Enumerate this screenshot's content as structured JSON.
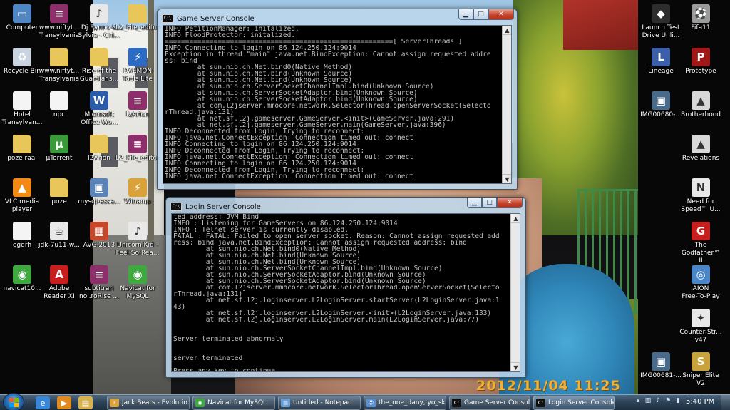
{
  "wallpaper": {
    "date_stamp": "2012/11/04  11:25"
  },
  "desktop_icons_left": [
    {
      "label": "Computer",
      "icon": "computer-icon",
      "color": "#4f86c6",
      "glyph": "▭"
    },
    {
      "label": "www.niftyt...\nTransylvania",
      "icon": "rar-archive-icon",
      "color": "#8c2f6b",
      "glyph": "≡"
    },
    {
      "label": "Dj Rynno &\nSylvia - Chi...",
      "icon": "audio-file-icon",
      "color": "#e8e8e8",
      "glyph": "♪"
    },
    {
      "label": "L2_File_editor",
      "icon": "folder-icon",
      "color": "#e9c65a",
      "glyph": ""
    },
    {
      "label": "Recycle Bin",
      "icon": "recycle-bin-icon",
      "color": "#c9d4e0",
      "glyph": "♻"
    },
    {
      "label": "www.niftyt...\nTransylvania",
      "icon": "folder-icon",
      "color": "#e9c65a",
      "glyph": ""
    },
    {
      "label": "Rise of the\nGuardians...",
      "icon": "folder-icon",
      "color": "#e9c65a",
      "glyph": ""
    },
    {
      "label": "DAEMON\nTools Lite",
      "icon": "daemon-tools-icon",
      "color": "#2b6bc4",
      "glyph": "⚡"
    },
    {
      "label": "Hotel\nTransylvan...",
      "icon": "text-file-icon",
      "color": "#f4f4f4",
      "glyph": ""
    },
    {
      "label": "npc",
      "icon": "text-file-icon",
      "color": "#f4f4f4",
      "glyph": ""
    },
    {
      "label": "Microsoft\nOffice Wo...",
      "icon": "word-icon",
      "color": "#2a5caa",
      "glyph": "W"
    },
    {
      "label": "l2Arion",
      "icon": "rar-archive-icon",
      "color": "#8c2f6b",
      "glyph": "≡"
    },
    {
      "label": "poze raal",
      "icon": "folder-icon",
      "color": "#e9c65a",
      "glyph": ""
    },
    {
      "label": "µTorrent",
      "icon": "utorrent-icon",
      "color": "#3a9a3a",
      "glyph": "µ"
    },
    {
      "label": "l2Arion",
      "icon": "folder-icon",
      "color": "#e9c65a",
      "glyph": ""
    },
    {
      "label": "L2_File_editor",
      "icon": "rar-archive-icon",
      "color": "#8c2f6b",
      "glyph": "≡"
    },
    {
      "label": "VLC media\nplayer",
      "icon": "vlc-icon",
      "color": "#f08a14",
      "glyph": "▲"
    },
    {
      "label": "poze",
      "icon": "folder-icon",
      "color": "#e9c65a",
      "glyph": ""
    },
    {
      "label": "mysql-esse...",
      "icon": "installer-icon",
      "color": "#5a84b8",
      "glyph": "▣"
    },
    {
      "label": "Winamp",
      "icon": "winamp-icon",
      "color": "#d9a23a",
      "glyph": "⚡"
    },
    {
      "label": "egdrh",
      "icon": "text-file-icon",
      "color": "#f4f4f4",
      "glyph": ""
    },
    {
      "label": "jdk-7u11-w...",
      "icon": "java-icon",
      "color": "#e8e8e8",
      "glyph": "☕"
    },
    {
      "label": "AVG 2013",
      "icon": "avg-icon",
      "color": "#c8462a",
      "glyph": "▦"
    },
    {
      "label": "Unicorn Kid -\nFeel So Rea...",
      "icon": "audio-file-icon",
      "color": "#e8e8e8",
      "glyph": "♪"
    },
    {
      "label": "navicat10...",
      "icon": "navicat-icon",
      "color": "#3fa83f",
      "glyph": "◉"
    },
    {
      "label": "Adobe\nReader XI",
      "icon": "adobe-reader-icon",
      "color": "#c81e1e",
      "glyph": "A"
    },
    {
      "label": "subtitrari\nnoi.roRise ...",
      "icon": "rar-archive-icon",
      "color": "#8c2f6b",
      "glyph": "≡"
    },
    {
      "label": "Navicat for\nMySQL",
      "icon": "navicat-icon",
      "color": "#3fa83f",
      "glyph": "◉"
    }
  ],
  "desktop_icons_right": [
    {
      "label": "Launch Test\nDrive Unli...",
      "icon": "game-icon",
      "color": "#2d2d2d",
      "glyph": "◆"
    },
    {
      "label": "Fifa11",
      "icon": "fifa-icon",
      "color": "#9a9a9a",
      "glyph": "⚽"
    },
    {
      "label": "Lineage",
      "icon": "lineage-icon",
      "color": "#3b5fa8",
      "glyph": "L"
    },
    {
      "label": "Prototype",
      "icon": "prototype-icon",
      "color": "#a01818",
      "glyph": "P"
    },
    {
      "label": "IMG00680-...",
      "icon": "image-file-icon",
      "color": "#4a6a8a",
      "glyph": "▣"
    },
    {
      "label": "Brotherhood",
      "icon": "assassins-creed-icon",
      "color": "#d8d8d8",
      "glyph": "▲"
    },
    {
      "label": "",
      "icon": "",
      "color": "",
      "glyph": ""
    },
    {
      "label": "Revelations",
      "icon": "assassins-creed-icon",
      "color": "#d8d8d8",
      "glyph": "▲"
    },
    {
      "label": "",
      "icon": "",
      "color": "",
      "glyph": ""
    },
    {
      "label": "Need for\nSpeed™ U...",
      "icon": "nfs-icon",
      "color": "#e8e8e8",
      "glyph": "N"
    },
    {
      "label": "",
      "icon": "",
      "color": "",
      "glyph": ""
    },
    {
      "label": "The\nGodfather™ II",
      "icon": "godfather-icon",
      "color": "#c81e1e",
      "glyph": "G"
    },
    {
      "label": "",
      "icon": "",
      "color": "",
      "glyph": ""
    },
    {
      "label": "AION\nFree-To-Play",
      "icon": "aion-icon",
      "color": "#4a86c8",
      "glyph": "◎"
    },
    {
      "label": "",
      "icon": "",
      "color": "",
      "glyph": ""
    },
    {
      "label": "Counter-Str...\nv47",
      "icon": "counter-strike-icon",
      "color": "#e8e8e8",
      "glyph": "✦"
    },
    {
      "label": "IMG00681-...",
      "icon": "image-file-icon",
      "color": "#4a6a8a",
      "glyph": "▣"
    },
    {
      "label": "Sniper Elite\nV2",
      "icon": "sniper-elite-icon",
      "color": "#c8a23a",
      "glyph": "S"
    }
  ],
  "game_console": {
    "title": "Game Server Console",
    "lines": [
      "INFO PetitionManager: initalized.",
      "INFO FloodProtector: initalized.",
      "========================================================[ ServerThreads ]",
      "INFO Connecting to login on 86.124.250.124:9014",
      "Exception in thread \"main\" java.net.BindException: Cannot assign requested addre",
      "ss: bind",
      "        at sun.nio.ch.Net.bind0(Native Method)",
      "        at sun.nio.ch.Net.bind(Unknown Source)",
      "        at sun.nio.ch.Net.bind(Unknown Source)",
      "        at sun.nio.ch.ServerSocketChannelImpl.bind(Unknown Source)",
      "        at sun.nio.ch.ServerSocketAdaptor.bind(Unknown Source)",
      "        at sun.nio.ch.ServerSocketAdaptor.bind(Unknown Source)",
      "        at com.l2jserver.mmocore.network.SelectorThread.openServerSocket(Selecto",
      "rThread.java:131)",
      "        at net.sf.l2j.gameserver.GameServer.<init>(GameServer.java:291)",
      "        at net.sf.l2j.gameserver.GameServer.main(GameServer.java:396)",
      "INFO Deconnected from Login, Trying to reconnect:",
      "INFO java.net.ConnectException: Connection timed out: connect",
      "INFO Connecting to login on 86.124.250.124:9014",
      "INFO Deconnected from Login, Trying to reconnect:",
      "INFO java.net.ConnectException: Connection timed out: connect",
      "INFO Connecting to login on 86.124.250.124:9014",
      "INFO Deconnected from Login, Trying to reconnect:",
      "INFO java.net.ConnectException: Connection timed out: connect"
    ]
  },
  "login_console": {
    "title": "Login Server Console",
    "lines": [
      "ted address: JVM_Bind",
      "INFO : Listening for GameServers on 86.124.250.124:9014",
      "INFO : Telnet server is currently disabled.",
      "FATAL : FATAL: Failed to open server socket. Reason: Cannot assign requested add",
      "ress: bind java.net.BindException: Cannot assign requested address: bind",
      "        at sun.nio.ch.Net.bind0(Native Method)",
      "        at sun.nio.ch.Net.bind(Unknown Source)",
      "        at sun.nio.ch.Net.bind(Unknown Source)",
      "        at sun.nio.ch.ServerSocketChannelImpl.bind(Unknown Source)",
      "        at sun.nio.ch.ServerSocketAdaptor.bind(Unknown Source)",
      "        at sun.nio.ch.ServerSocketAdaptor.bind(Unknown Source)",
      "        at com.l2jserver.mmocore.network.SelectorThread.openServerSocket(Selecto",
      "rThread.java:131)",
      "        at net.sf.l2j.loginserver.L2LoginServer.startServer(L2LoginServer.java:1",
      "43)",
      "        at net.sf.l2j.loginserver.L2LoginServer.<init>(L2LoginServer.java:133)",
      "        at net.sf.l2j.loginserver.L2LoginServer.main(L2LoginServer.java:77)",
      "",
      "",
      "Server terminated abnormaly",
      "",
      "",
      "server terminated",
      "",
      "Press any key to continue . . ."
    ]
  },
  "taskbar": {
    "start_label": "Start",
    "quick_launch": [
      {
        "icon": "internet-explorer-icon",
        "color": "#3a86d6",
        "glyph": "e"
      },
      {
        "icon": "windows-media-player-icon",
        "color": "#e08a1e",
        "glyph": "▶"
      },
      {
        "icon": "windows-explorer-icon",
        "color": "#d8b24a",
        "glyph": "▤"
      }
    ],
    "items": [
      {
        "label": "Jack Beats - Evolutio...",
        "icon": "winamp-icon",
        "color": "#d9a23a",
        "glyph": "⚡"
      },
      {
        "label": "Navicat for MySQL",
        "icon": "navicat-icon",
        "color": "#3fa83f",
        "glyph": "◉"
      },
      {
        "label": "Untitled - Notepad",
        "icon": "notepad-icon",
        "color": "#6aa0d8",
        "glyph": "▤"
      },
      {
        "label": "the_one_dany, yo_sk...",
        "icon": "yahoo-messenger-icon",
        "color": "#5a8fd0",
        "glyph": "☺"
      },
      {
        "label": "Game Server Console",
        "icon": "cmd-icon",
        "color": "#111111",
        "glyph": "C:"
      },
      {
        "label": "Login Server Console",
        "icon": "cmd-icon",
        "color": "#111111",
        "glyph": "C:"
      }
    ],
    "tray_icons": [
      "network-icon",
      "volume-icon",
      "flag-icon",
      "shield-icon",
      "power-icon"
    ],
    "clock": "5:40 PM"
  }
}
